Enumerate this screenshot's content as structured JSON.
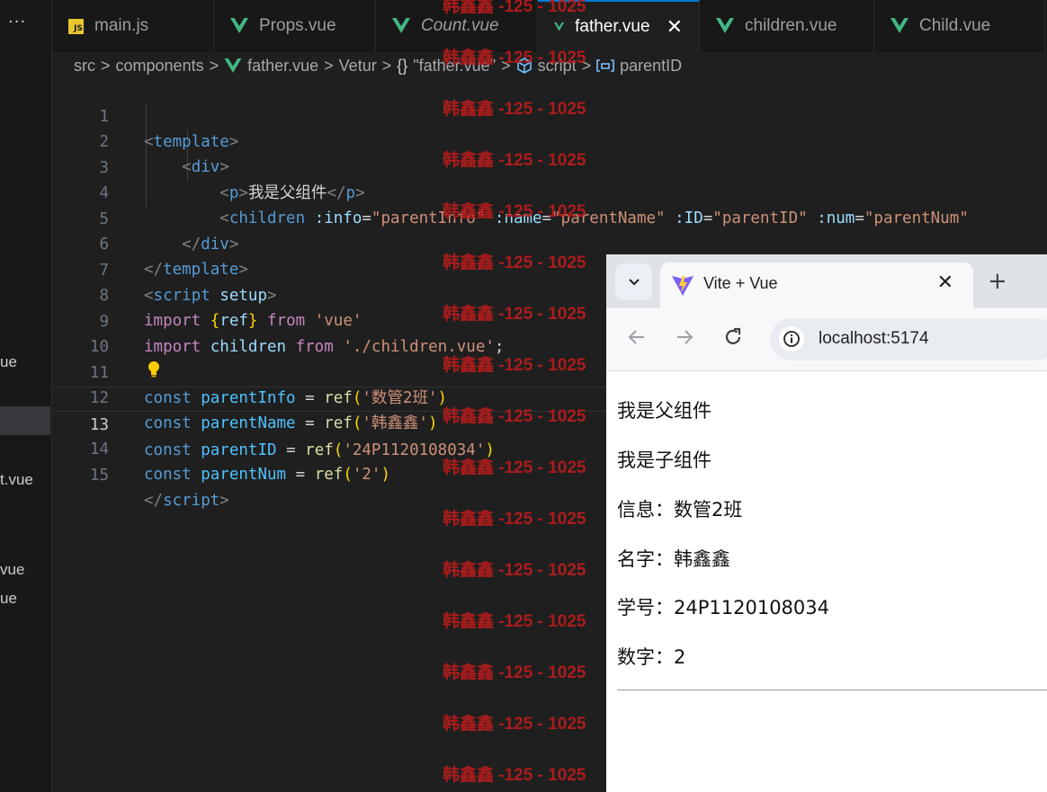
{
  "sidebar": {
    "more_label": "···",
    "fragments": [
      "ue",
      "t.vue",
      "vue",
      "ue"
    ]
  },
  "tabs": [
    {
      "label": "main.js",
      "icon": "js-file-icon",
      "italic": false,
      "active": false
    },
    {
      "label": "Props.vue",
      "icon": "vue-file-icon",
      "italic": false,
      "active": false
    },
    {
      "label": "Count.vue",
      "icon": "vue-file-icon",
      "italic": true,
      "active": false
    },
    {
      "label": "father.vue",
      "icon": "vue-file-icon",
      "italic": false,
      "active": true
    },
    {
      "label": "children.vue",
      "icon": "vue-file-icon",
      "italic": false,
      "active": false
    },
    {
      "label": "Child.vue",
      "icon": "vue-file-icon",
      "italic": false,
      "active": false
    }
  ],
  "js_badge": "JS",
  "tab_close_glyph": "✕",
  "breadcrumb": {
    "src": "src",
    "components": "components",
    "file": "father.vue",
    "vetur": "Vetur",
    "obj_icon": "{}",
    "obj": "\"father.vue\"",
    "script": "script",
    "symbol": "parentID",
    "separator": ">"
  },
  "editor": {
    "current_line": 13,
    "line_numbers": [
      "1",
      "2",
      "3",
      "4",
      "5",
      "6",
      "7",
      "8",
      "9",
      "10",
      "11",
      "12",
      "13",
      "14",
      "15"
    ],
    "code": {
      "l1_open": "<",
      "l1_tag": "template",
      "l1_close": ">",
      "l2_open": "<",
      "l2_tag": "div",
      "l2_close": ">",
      "l3_open": "<",
      "l3_tag": "p",
      "l3_close": ">",
      "l3_text": "我是父组件",
      "l3_end_open": "</",
      "l3_end_tag": "p",
      "l3_end_close": ">",
      "l4_open": "<",
      "l4_tag": "children",
      "l4_attr1": ":info",
      "l4_eq1": "=",
      "l4_val1": "\"parentInfo\"",
      "l4_attr2": ":name",
      "l4_eq2": "=",
      "l4_val2": "\"parentName\"",
      "l4_attr3": ":ID",
      "l4_eq3": "=",
      "l4_val3": "\"parentID\"",
      "l4_attr4": ":num",
      "l4_eq4": "=",
      "l4_val4": "\"parentNum\"",
      "l5_open": "</",
      "l5_tag": "div",
      "l5_close": ">",
      "l6_open": "</",
      "l6_tag": "template",
      "l6_close": ">",
      "l7_open": "<",
      "l7_tag": "script",
      "l7_attr": "setup",
      "l7_close": ">",
      "l8_import": "import",
      "l8_brace_open": "{",
      "l8_ref": "ref",
      "l8_brace_close": "}",
      "l8_from": "from",
      "l8_str": "'vue'",
      "l9_import": "import",
      "l9_name": "children",
      "l9_from": "from",
      "l9_str": "'./children.vue'",
      "l9_semi": ";",
      "const_kw": "const",
      "l11_name": "parentInfo",
      "l11_str": "'数管2班'",
      "l12_name": "parentName",
      "l12_str": "'韩鑫鑫'",
      "l13_name": "parentID",
      "l13_str": "'24P1120108034'",
      "l14_name": "parentNum",
      "l14_str": "'2'",
      "eq": "=",
      "ref_fn": "ref",
      "paren_open": "(",
      "paren_close": ")",
      "l15_open": "</",
      "l15_tag": "script",
      "l15_close": ">"
    }
  },
  "watermark": {
    "text": "韩鑫鑫 -125 - 1025",
    "color": "#b91c1c"
  },
  "browser": {
    "tab_title": "Vite + Vue",
    "tab_close": "✕",
    "new_tab": "+",
    "url": "localhost:5174",
    "content": [
      "我是父组件",
      "我是子组件",
      "信息：数管2班",
      "名字：韩鑫鑫",
      "学号：24P1120108034",
      "数字：2"
    ]
  },
  "colors": {
    "editor_bg": "#1f1f1f",
    "accent": "#0078d4",
    "vue_green": "#41b883"
  }
}
